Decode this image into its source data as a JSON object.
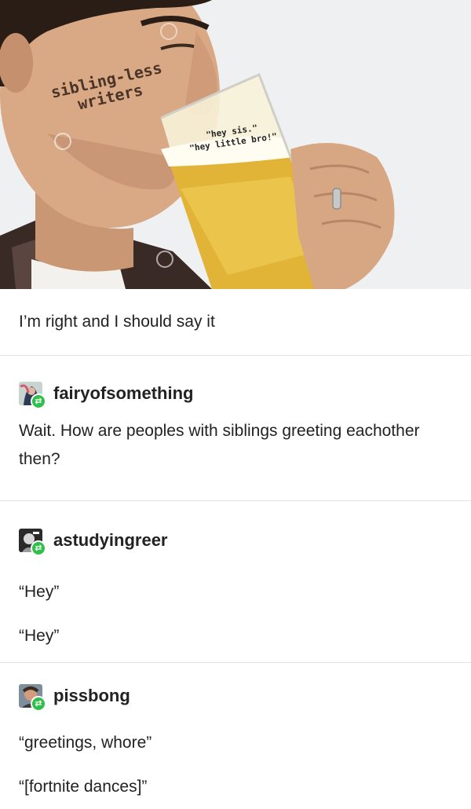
{
  "meme": {
    "caption_main": "sibling-less\nwriters",
    "caption_glass_line1": "\"hey sis.\"",
    "caption_glass_line2": "\"hey little bro!\""
  },
  "post": {
    "text": "I’m right and I should say it"
  },
  "reblogs": [
    {
      "username": "fairyofsomething",
      "avatar_icon": "fairy-avatar",
      "lines": [
        "Wait. How are peoples with siblings greeting eachother then?"
      ]
    },
    {
      "username": "astudyingreer",
      "avatar_icon": "bw-portrait-avatar",
      "lines": [
        "“Hey”",
        "“Hey”"
      ]
    },
    {
      "username": "pissbong",
      "avatar_icon": "man-photo-avatar",
      "lines": [
        "“greetings, whore”",
        "“[fortnite dances]”"
      ]
    }
  ],
  "colors": {
    "reblog_badge": "#2fbf4a",
    "divider": "#e3e3e3"
  }
}
